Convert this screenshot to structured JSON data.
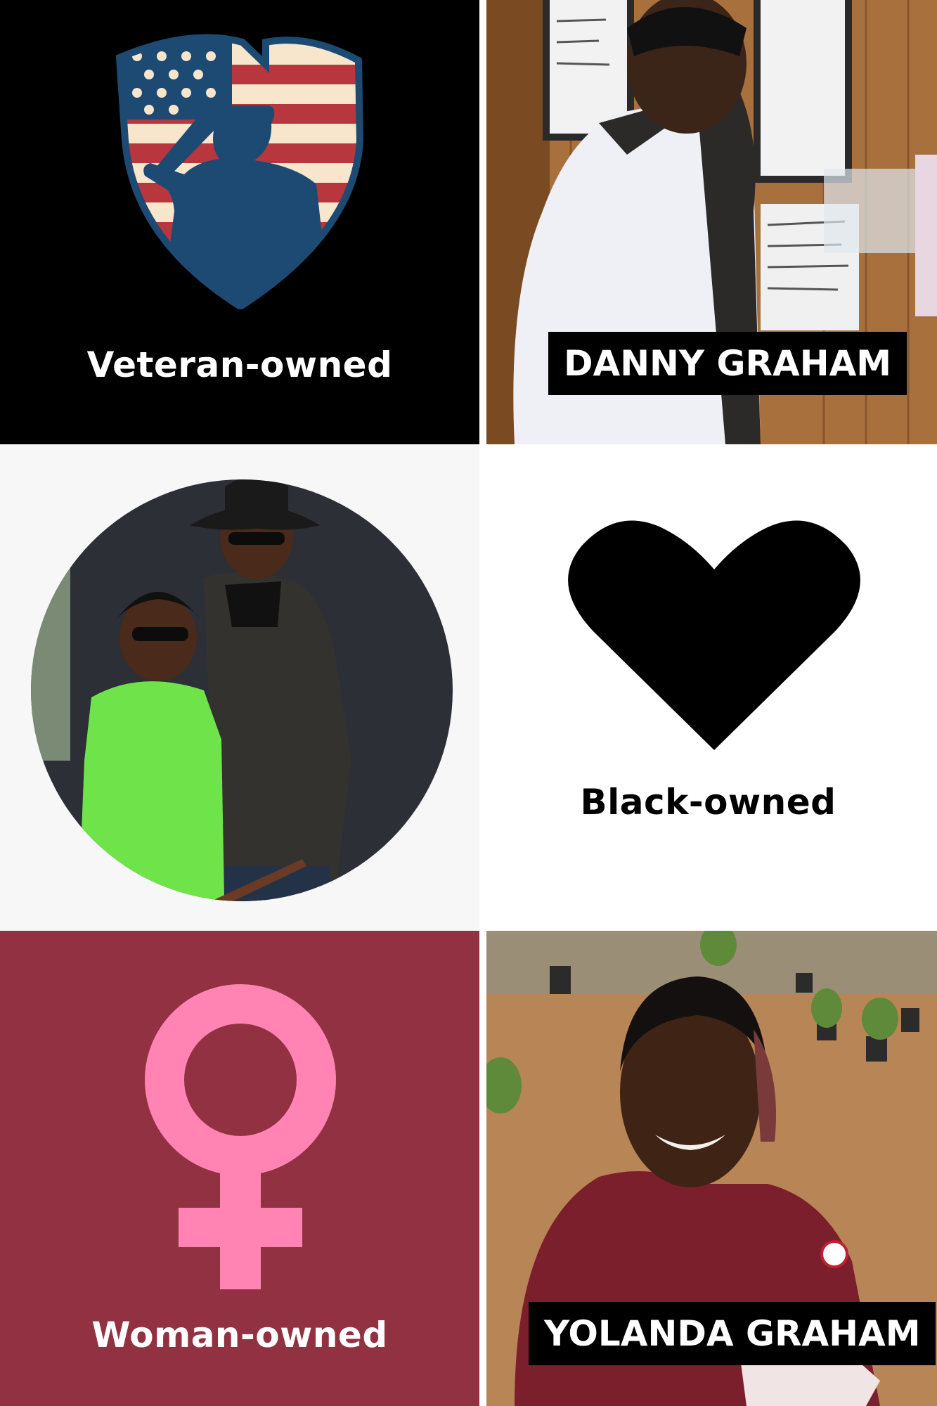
{
  "tiles": {
    "veteran": {
      "caption": "Veteran-owned",
      "icon": "saluting-soldier-flag-shield-icon",
      "background": "#000000",
      "text_color": "#ffffff"
    },
    "danny": {
      "name": "DANNY GRAHAM"
    },
    "couple": {
      "background": "#f7f7f8"
    },
    "black": {
      "caption": "Black-owned",
      "icon": "heart-icon",
      "background": "#ffffff",
      "text_color": "#000000"
    },
    "woman": {
      "caption": "Woman-owned",
      "icon": "female-symbol-icon",
      "background": "#923142",
      "symbol_color": "#ff84b4",
      "text_color": "#ffffff"
    },
    "yolanda": {
      "name": "YOLANDA GRAHAM"
    }
  },
  "colors": {
    "flag_navy": "#1d4a73",
    "flag_red": "#b8363d",
    "flag_cream": "#f7e6cc"
  }
}
